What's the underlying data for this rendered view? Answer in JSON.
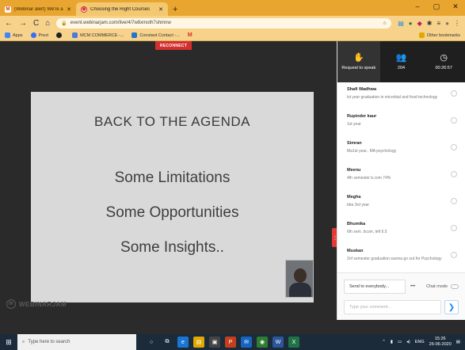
{
  "browser": {
    "tabs": [
      {
        "label": "(Webinar alert) We're about to s",
        "icon": "gmail-icon",
        "active": false
      },
      {
        "label": "Choosing the Right Courses",
        "icon": "webinarjam-icon",
        "active": true
      }
    ],
    "new_tab": "+",
    "window_controls": [
      "–",
      "▢",
      "✕"
    ],
    "url": "event.webinarjam.com/live/4/7w8xmoth7shmnw",
    "bookmarks": [
      {
        "label": "Apps",
        "color": "#4285f4"
      },
      {
        "label": "Prezi",
        "color": "#3b6cf6"
      },
      {
        "label": "",
        "color": "#222222"
      },
      {
        "label": "MCM COMMERCE -...",
        "color": "#4a7bd8"
      },
      {
        "label": "Constant Contact -...",
        "color": "#1e77c9"
      },
      {
        "label": "M",
        "color": "#d93025"
      }
    ],
    "other_bookmarks": "Other bookmarks"
  },
  "webinar": {
    "reconnect_label": "RECONNECT",
    "slide": {
      "heading": "BACK TO THE AGENDA",
      "lines": [
        "Some Limitations",
        "Some Opportunities",
        "Some Insights.."
      ]
    },
    "brand": "WEBINARJAM"
  },
  "panel": {
    "top": [
      {
        "icon": "hand-icon",
        "glyph": "✋",
        "label": "Request to speak"
      },
      {
        "icon": "people-icon",
        "glyph": "👥",
        "label": "204"
      },
      {
        "icon": "clock-icon",
        "glyph": "◷",
        "label": "00:26:57"
      }
    ],
    "attendees": [
      {
        "name": "Shafi Wadhwa",
        "sub": "lst year graduation in microbial and food technology"
      },
      {
        "name": "Rupinder kaur",
        "sub": "1st year"
      },
      {
        "name": "Simran",
        "sub": "Ma1st year.. MA psychology"
      },
      {
        "name": "Meenu",
        "sub": "4th semester b.com 74%"
      },
      {
        "name": "Megha",
        "sub": "bba 3rd year"
      },
      {
        "name": "Bhumika",
        "sub": "6th sem. bcom, left 6.5"
      },
      {
        "name": "Muskan",
        "sub": "2nf semester graduation wanna go out for Psychology"
      }
    ],
    "send_to": "Send to everybody...",
    "send_more": "•••",
    "chat_mode": "Chat mode",
    "comment_placeholder": "Type your comment...",
    "send_glyph": "❯"
  },
  "taskbar": {
    "search_placeholder": "Type here to search",
    "apps": [
      {
        "icon": "search-circle-icon",
        "glyph": "○",
        "color": "#1c2b3a"
      },
      {
        "icon": "task-view-icon",
        "glyph": "⧉",
        "color": "#1c2b3a"
      },
      {
        "icon": "edge-icon",
        "glyph": "e",
        "color": "#1976d2"
      },
      {
        "icon": "file-explorer-icon",
        "glyph": "▤",
        "color": "#e0a800"
      },
      {
        "icon": "store-icon",
        "glyph": "▣",
        "color": "#444444"
      },
      {
        "icon": "powerpoint-icon",
        "glyph": "P",
        "color": "#c43e1c"
      },
      {
        "icon": "mail-icon",
        "glyph": "✉",
        "color": "#1565c0"
      },
      {
        "icon": "chrome-icon",
        "glyph": "◉",
        "color": "#2e7d32"
      },
      {
        "icon": "word-icon",
        "glyph": "W",
        "color": "#2b579a"
      },
      {
        "icon": "excel-icon",
        "glyph": "X",
        "color": "#217346"
      }
    ],
    "tray_lang": "ENG",
    "time": "15:26",
    "date": "26-06-2020"
  }
}
